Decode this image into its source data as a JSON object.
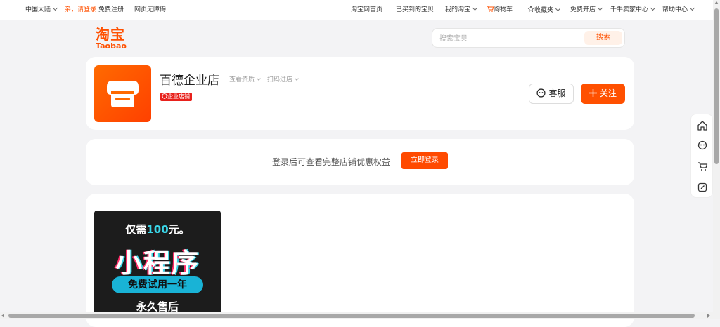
{
  "topbar": {
    "region": "中国大陆",
    "greeting": "亲，请登录",
    "register": "免费注册",
    "accessible": "网页无障碍",
    "home": "淘宝网首页",
    "bought": "已买到的宝贝",
    "my_taobao": "我的淘宝",
    "cart": "购物车",
    "favorites": "收藏夹",
    "open_store": "免费开店",
    "seller_center": "千牛卖家中心",
    "help": "帮助中心"
  },
  "logo": {
    "cn": "淘宝",
    "en": "Taobao"
  },
  "search": {
    "placeholder": "搜索宝贝",
    "button": "搜索"
  },
  "shop": {
    "name": "百德企业店",
    "qualification": "查看资质",
    "scan": "扫码进店",
    "badge": "企业店铺",
    "service_label": "客服",
    "follow_label": "关注"
  },
  "login_prompt": {
    "text": "登录后可查看完整店铺优惠权益",
    "button": "立即登录"
  },
  "promo": {
    "line1_prefix": "仅需",
    "line1_amount": "100",
    "line1_suffix": "元。",
    "line2": "小程序",
    "line3": "免费试用一年",
    "line4": "永久售后"
  },
  "colors": {
    "brand": "#ff5000",
    "badge": "#e8211c",
    "promo_accent": "#3ad6e8"
  },
  "sidebar_icons": [
    "home-icon",
    "service-icon",
    "cart-icon",
    "edit-icon"
  ]
}
